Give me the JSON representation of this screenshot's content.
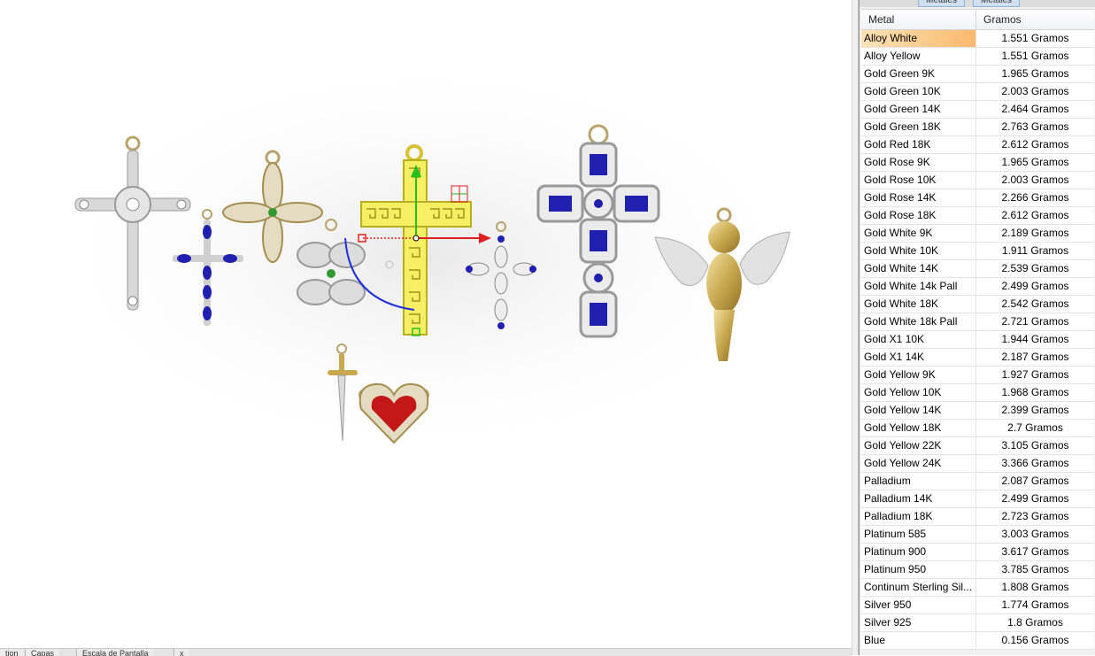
{
  "colors": {
    "gold": "#d9c37a",
    "silver": "#c9c9c9",
    "sapphire": "#1f1fb0",
    "emerald": "#2e9a2e",
    "ruby": "#c41818",
    "highlight": "#f5f062"
  },
  "viewport": {
    "objects": [
      "diamond-cross",
      "sapphire-cross",
      "flower-pendant",
      "clover-pendant",
      "greek-key-cross",
      "small-sapphire-cross",
      "emerald-cut-cross",
      "angel-pendant",
      "sword-pendant",
      "ruby-heart-pendant"
    ],
    "gizmo": [
      "move-x-axis-arrow",
      "move-y-axis-arrow",
      "rotate-arc-handle",
      "planar-move-handle"
    ]
  },
  "bottom_tabs": [
    "tion",
    "Capas",
    "Escala de Pantalla",
    "x"
  ],
  "panel": {
    "tabs": [
      "Metales",
      "Metales"
    ],
    "table": {
      "headers": {
        "metal": "Metal",
        "grams": "Gramos"
      },
      "rows": [
        {
          "metal": "Alloy White",
          "grams": "1.551 Gramos"
        },
        {
          "metal": "Alloy Yellow",
          "grams": "1.551 Gramos"
        },
        {
          "metal": "Gold Green 9K",
          "grams": "1.965 Gramos"
        },
        {
          "metal": "Gold Green 10K",
          "grams": "2.003 Gramos"
        },
        {
          "metal": "Gold Green 14K",
          "grams": "2.464 Gramos"
        },
        {
          "metal": "Gold Green 18K",
          "grams": "2.763 Gramos"
        },
        {
          "metal": "Gold Red 18K",
          "grams": "2.612 Gramos"
        },
        {
          "metal": "Gold Rose 9K",
          "grams": "1.965 Gramos"
        },
        {
          "metal": "Gold Rose 10K",
          "grams": "2.003 Gramos"
        },
        {
          "metal": "Gold Rose 14K",
          "grams": "2.266 Gramos"
        },
        {
          "metal": "Gold Rose 18K",
          "grams": "2.612 Gramos"
        },
        {
          "metal": "Gold White 9K",
          "grams": "2.189 Gramos"
        },
        {
          "metal": "Gold White 10K",
          "grams": "1.911 Gramos"
        },
        {
          "metal": "Gold White 14K",
          "grams": "2.539 Gramos"
        },
        {
          "metal": "Gold White 14k Pall",
          "grams": "2.499 Gramos"
        },
        {
          "metal": "Gold White 18K",
          "grams": "2.542 Gramos"
        },
        {
          "metal": "Gold White 18k Pall",
          "grams": "2.721 Gramos"
        },
        {
          "metal": "Gold X1 10K",
          "grams": "1.944 Gramos"
        },
        {
          "metal": "Gold X1 14K",
          "grams": "2.187 Gramos"
        },
        {
          "metal": "Gold Yellow 9K",
          "grams": "1.927 Gramos"
        },
        {
          "metal": "Gold Yellow 10K",
          "grams": "1.968 Gramos"
        },
        {
          "metal": "Gold Yellow 14K",
          "grams": "2.399 Gramos"
        },
        {
          "metal": "Gold Yellow 18K",
          "grams": "2.7 Gramos"
        },
        {
          "metal": "Gold Yellow 22K",
          "grams": "3.105 Gramos"
        },
        {
          "metal": "Gold Yellow 24K",
          "grams": "3.366 Gramos"
        },
        {
          "metal": "Palladium",
          "grams": "2.087 Gramos"
        },
        {
          "metal": "Palladium 14K",
          "grams": "2.499 Gramos"
        },
        {
          "metal": "Palladium 18K",
          "grams": "2.723 Gramos"
        },
        {
          "metal": "Platinum 585",
          "grams": "3.003 Gramos"
        },
        {
          "metal": "Platinum 900",
          "grams": "3.617 Gramos"
        },
        {
          "metal": "Platinum 950",
          "grams": "3.785 Gramos"
        },
        {
          "metal": "Continum Sterling Sil...",
          "grams": "1.808 Gramos"
        },
        {
          "metal": "Silver 950",
          "grams": "1.774 Gramos"
        },
        {
          "metal": "Silver 925",
          "grams": "1.8 Gramos"
        },
        {
          "metal": "Blue",
          "grams": "0.156 Gramos"
        }
      ]
    }
  }
}
